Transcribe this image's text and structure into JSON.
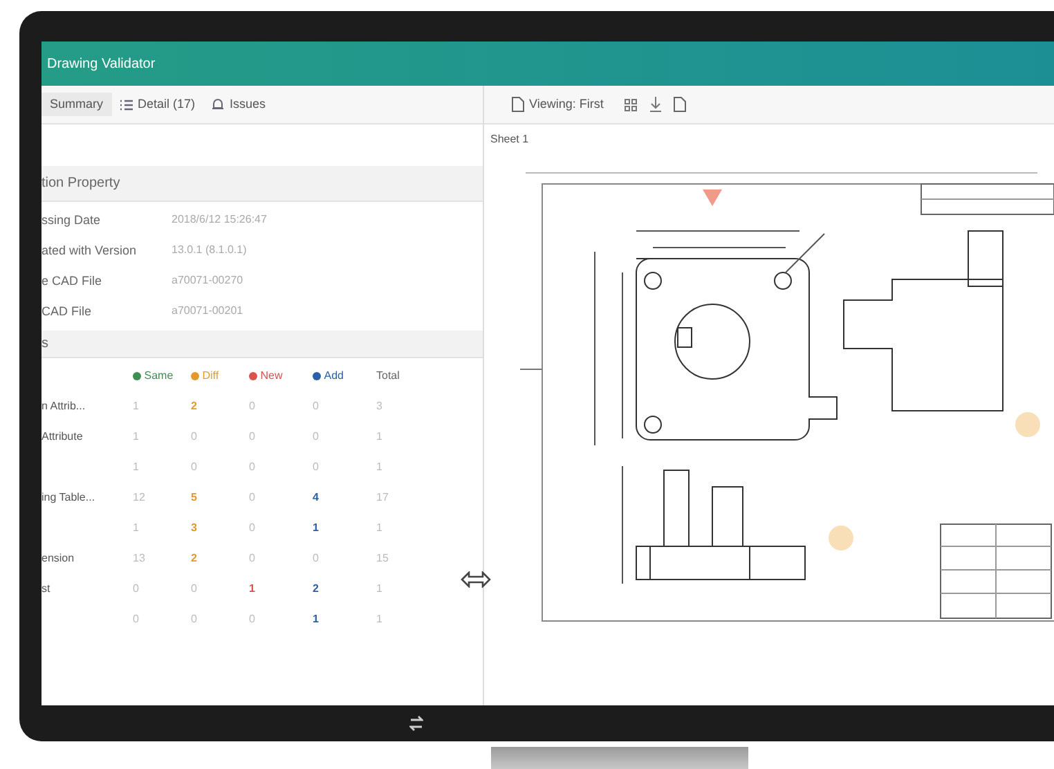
{
  "window": {
    "title": "Drawing Validator"
  },
  "tabs": [
    {
      "label": "Summary",
      "kind": "plain",
      "selected": true
    },
    {
      "label": "Detail (17)",
      "kind": "list",
      "selected": false
    },
    {
      "label": "Issues",
      "kind": "alert",
      "selected": false
    }
  ],
  "viewer_toolbar": {
    "viewing": "Viewing: First"
  },
  "sheet_label": "Sheet 1",
  "property_section": {
    "title": "tion Property",
    "rows": [
      {
        "label": "ssing Date",
        "value": "2018/6/12 15:26:47"
      },
      {
        "label": "ated with Version",
        "value": "13.0.1 (8.1.0.1)"
      },
      {
        "label": "e CAD File",
        "value": "a70071-00270"
      },
      {
        "label": "CAD File",
        "value": "a70071-00201"
      }
    ]
  },
  "result_section": {
    "title": "s",
    "columns": [
      {
        "label": "Same",
        "color": "#3f8f52"
      },
      {
        "label": "Diff",
        "color": "#e39a2d"
      },
      {
        "label": "New",
        "color": "#d9534f"
      },
      {
        "label": "Add",
        "color": "#2b5fa8"
      },
      {
        "label": "Total"
      }
    ],
    "rows": [
      {
        "label": "n Attrib...",
        "cells": [
          {
            "text": "1",
            "emphasis": false
          },
          {
            "text": "2",
            "emphasis": true
          },
          {
            "text": "0",
            "emphasis": false
          },
          {
            "text": "0",
            "emphasis": false
          },
          {
            "text": "3",
            "emphasis": false
          }
        ]
      },
      {
        "label": "Attribute",
        "cells": [
          {
            "text": "1",
            "emphasis": false
          },
          {
            "text": "0",
            "emphasis": false
          },
          {
            "text": "0",
            "emphasis": false
          },
          {
            "text": "0",
            "emphasis": false
          },
          {
            "text": "1",
            "emphasis": false
          }
        ]
      },
      {
        "cells": [
          {
            "text": "1",
            "emphasis": false
          },
          {
            "text": "0",
            "emphasis": false
          },
          {
            "text": "0",
            "emphasis": false
          },
          {
            "text": "0",
            "emphasis": false
          },
          {
            "text": "1",
            "emphasis": false
          }
        ]
      },
      {
        "label": "ing Table...",
        "cells": [
          {
            "text": "12",
            "emphasis": false
          },
          {
            "text": "5",
            "emphasis": true
          },
          {
            "text": "0",
            "emphasis": false
          },
          {
            "text": "4",
            "emphasis": true
          },
          {
            "text": "17",
            "emphasis": false
          }
        ]
      },
      {
        "cells": [
          {
            "text": "1",
            "emphasis": false
          },
          {
            "text": "3",
            "emphasis": true
          },
          {
            "text": "0",
            "emphasis": false
          },
          {
            "text": "1",
            "emphasis": true
          },
          {
            "text": "1",
            "emphasis": false
          }
        ]
      },
      {
        "label": "ension",
        "cells": [
          {
            "text": "13",
            "emphasis": false
          },
          {
            "text": "2",
            "emphasis": true
          },
          {
            "text": "0",
            "emphasis": false
          },
          {
            "text": "0",
            "emphasis": false
          },
          {
            "text": "15",
            "emphasis": false
          }
        ]
      },
      {
        "label": "st",
        "cells": [
          {
            "text": "0",
            "emphasis": false
          },
          {
            "text": "0",
            "emphasis": false
          },
          {
            "text": "1",
            "emphasis": true
          },
          {
            "text": "2",
            "emphasis": true
          },
          {
            "text": "1",
            "emphasis": false
          }
        ]
      },
      {
        "cells": [
          {
            "text": "0",
            "emphasis": false
          },
          {
            "text": "0",
            "emphasis": false
          },
          {
            "text": "0",
            "emphasis": false
          },
          {
            "text": "1",
            "emphasis": true
          },
          {
            "text": "1",
            "emphasis": false
          }
        ]
      }
    ]
  }
}
